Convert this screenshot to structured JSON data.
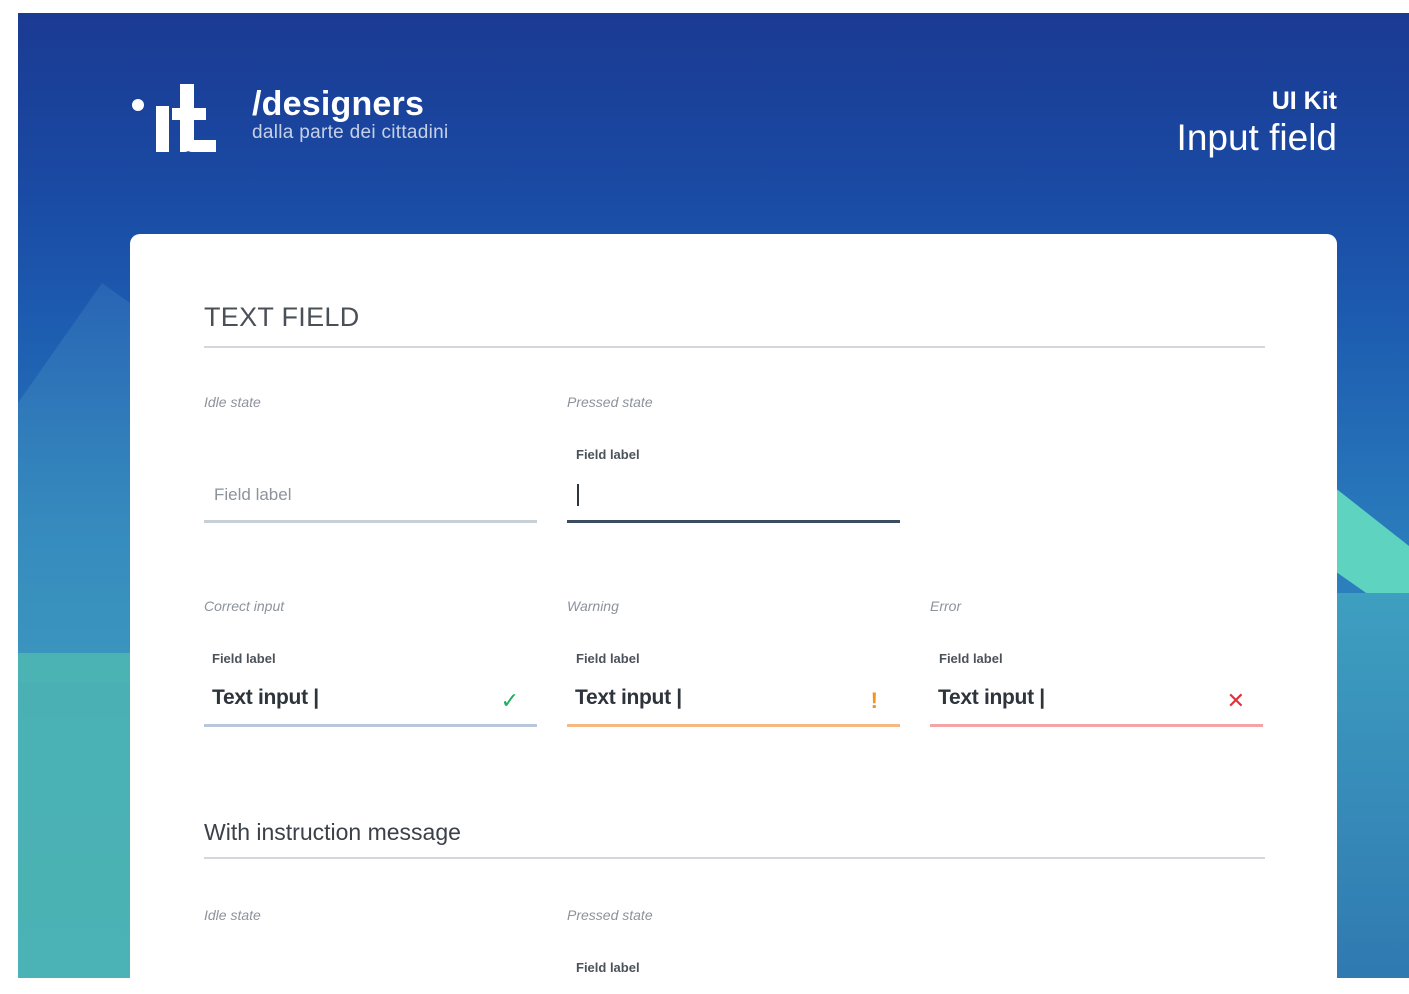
{
  "brand": {
    "title": "/designers",
    "subtitle": "dalla parte dei cittadini"
  },
  "header": {
    "kit_label": "UI Kit",
    "kit_title": "Input field"
  },
  "sections": {
    "text_field": "TEXT FIELD",
    "instruction": "With instruction message"
  },
  "states": {
    "idle": "Idle state",
    "pressed": "Pressed state",
    "correct": "Correct input",
    "warning": "Warning",
    "error": "Error",
    "idle2": "Idle state",
    "pressed2": "Pressed state"
  },
  "fields": {
    "idle_placeholder": "Field label",
    "pressed_label": "Field label",
    "correct_label": "Field label",
    "warning_label": "Field label",
    "error_label": "Field label",
    "instruction_pressed_label": "Field label",
    "correct_value": "Text input |",
    "warning_value": "Text input |",
    "error_value": "Text input |"
  },
  "icons": {
    "correct": "check-icon",
    "warning": "exclamation-icon",
    "error": "cross-icon"
  },
  "colors": {
    "header_blue": "#1b3a93",
    "correct": "#1fae5d",
    "warning": "#f2941e",
    "error": "#e1313b"
  }
}
